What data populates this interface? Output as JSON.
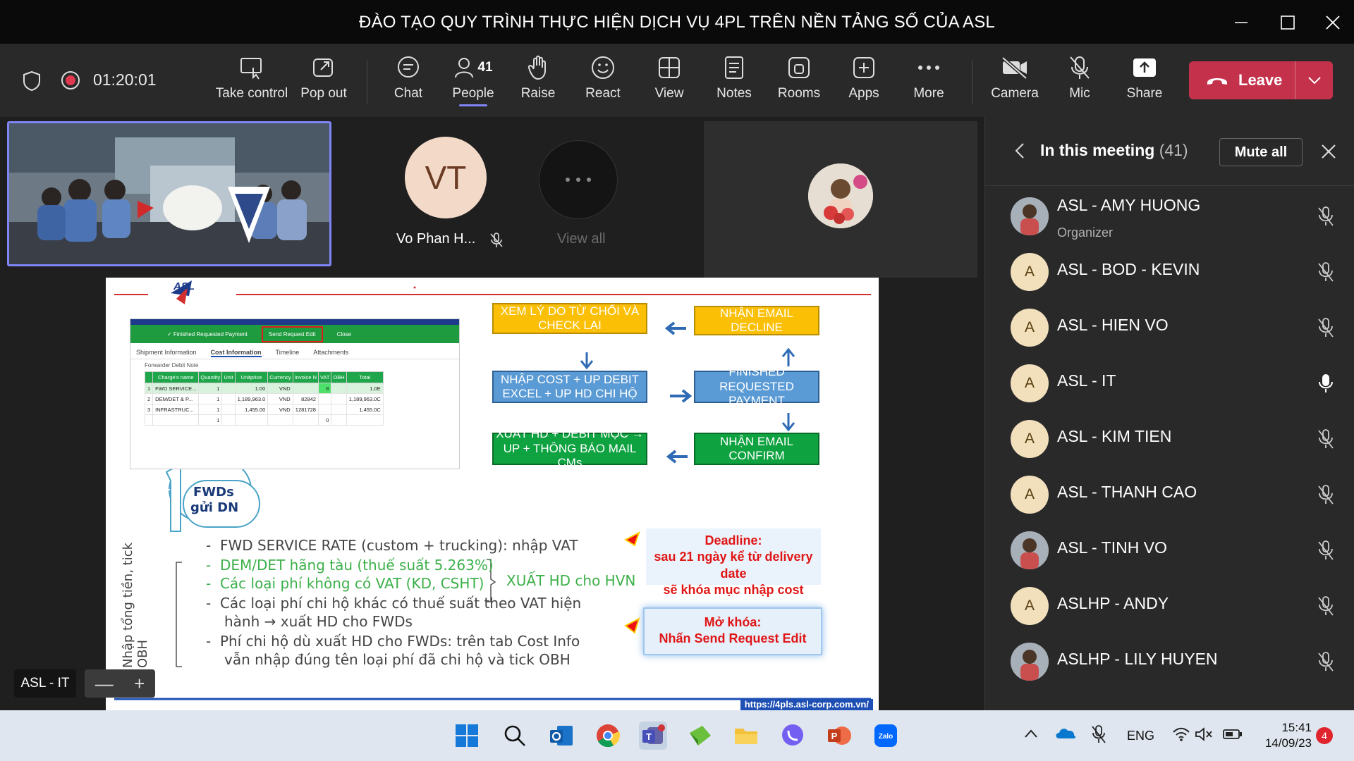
{
  "window": {
    "title": "ĐÀO TẠO QUY TRÌNH THỰC HIỆN DỊCH VỤ 4PL TRÊN NỀN TẢNG SỐ CỦA ASL"
  },
  "toolbar": {
    "timer": "01:20:01",
    "items": {
      "take_control": "Take control",
      "pop_out": "Pop out",
      "chat": "Chat",
      "people": "People",
      "people_count": "41",
      "raise": "Raise",
      "react": "React",
      "view": "View",
      "notes": "Notes",
      "rooms": "Rooms",
      "apps": "Apps",
      "more": "More",
      "camera": "Camera",
      "mic": "Mic",
      "share": "Share"
    },
    "leave": "Leave",
    "colors": {
      "leave": "#c4314b",
      "accent": "#7f85f5"
    }
  },
  "stage": {
    "tile_vt_initials": "VT",
    "tile_vt_name": "Vo Phan H...",
    "view_all": "View all",
    "self_label": "ASL - IT",
    "zoom_minus": "—",
    "zoom_plus": "+"
  },
  "slide": {
    "logo": "ASL",
    "ui_mock": {
      "btn_finished": "✓ Finished Requested Payment",
      "btn_send": "Send Request Edit",
      "btn_close": "Close",
      "tabs": [
        "Shipment Information",
        "Cost Information",
        "Timeline",
        "Attachments"
      ],
      "section": "Forwarder Debit Note",
      "headers": [
        "Charge's name",
        "Quantity",
        "Unit",
        "Unitprice",
        "Currency",
        "Invoice N",
        "VAT",
        "OBH",
        "Total"
      ],
      "rows": [
        [
          "1",
          "FWD SERVICE...",
          "1",
          "",
          "1.00",
          "VND",
          "",
          "8",
          "",
          "1.0E"
        ],
        [
          "2",
          "DEM/DET & P...",
          "1",
          "",
          "1,189,963.0",
          "VND",
          "82842",
          "",
          "",
          "1,189,963.0C"
        ],
        [
          "3",
          "INFRASTRUC...",
          "1",
          "",
          "1,455.00",
          "VND",
          "1281728",
          "",
          "",
          "1,455.0C"
        ],
        [
          "",
          "",
          "1",
          "",
          "",
          "",
          "",
          "0",
          "",
          ""
        ]
      ]
    },
    "flow": {
      "xem_ly_do": "XEM LÝ DO TỪ CHỐI VÀ CHECK LẠI",
      "nhan_email_decline": "NHẬN EMAIL DECLINE",
      "nhap_cost": "NHẬP COST + UP DEBIT EXCEL + UP HD CHI HỘ",
      "finished_requested": "FINISHED REQUESTED PAYMENT",
      "xuat_hd": "XUẤT HD + DEBIT MỘC → UP + THÔNG BÁO MAIL CMs",
      "nhan_email_confirm": "NHẬN EMAIL CONFIRM"
    },
    "step": {
      "number": "1",
      "line1": "FWDs",
      "line2": "gửi DN"
    },
    "vertical_text": "Nhập tổng tiền, tick OBH",
    "bullets": [
      "FWD SERVICE RATE (custom + trucking): nhập VAT",
      "DEM/DET hãng tàu (thuế suất 5.263%)",
      "Các loại phí không có VAT (KD, CSHT)",
      "Các loại phí chi hộ khác có thuế suất theo VAT hiện",
      "hành → xuất HD cho FWDs",
      "Phí chi hộ dù xuất HD cho FWDs: trên tab Cost Info",
      "vẫn nhập đúng tên loại phí đã chi hộ và tick OBH"
    ],
    "xuat_hd_hvn": "XUẤT HD cho HVN",
    "deadline": {
      "title": "Deadline:",
      "line1": "sau 21 ngày kể từ delivery date",
      "line2": "sẽ khóa mục nhập cost"
    },
    "unlock": {
      "title": "Mở khóa:",
      "line1": "Nhấn Send Request Edit"
    },
    "footer_url": "https://4pls.asl-corp.com.vn/"
  },
  "panel": {
    "title": "In this meeting",
    "count": "(41)",
    "mute_all": "Mute all",
    "participants": [
      {
        "name": "ASL - AMY HUONG",
        "role": "Organizer",
        "initial": "",
        "photo": true,
        "mic": "muted"
      },
      {
        "name": "ASL - BOD - KEVIN",
        "role": "",
        "initial": "A",
        "photo": false,
        "mic": "muted"
      },
      {
        "name": "ASL - HIEN VO",
        "role": "",
        "initial": "A",
        "photo": false,
        "mic": "muted"
      },
      {
        "name": "ASL - IT",
        "role": "",
        "initial": "A",
        "photo": false,
        "mic": "on"
      },
      {
        "name": "ASL - KIM TIEN",
        "role": "",
        "initial": "A",
        "photo": false,
        "mic": "muted"
      },
      {
        "name": "ASL - THANH CAO",
        "role": "",
        "initial": "A",
        "photo": false,
        "mic": "muted"
      },
      {
        "name": "ASL - TINH VO",
        "role": "",
        "initial": "",
        "photo": true,
        "mic": "muted"
      },
      {
        "name": "ASLHP - ANDY",
        "role": "",
        "initial": "A",
        "photo": false,
        "mic": "muted"
      },
      {
        "name": "ASLHP - LILY HUYEN",
        "role": "",
        "initial": "",
        "photo": true,
        "mic": "muted"
      }
    ]
  },
  "taskbar": {
    "lang": "ENG",
    "time": "15:41",
    "date": "14/09/23",
    "notif": "4"
  }
}
